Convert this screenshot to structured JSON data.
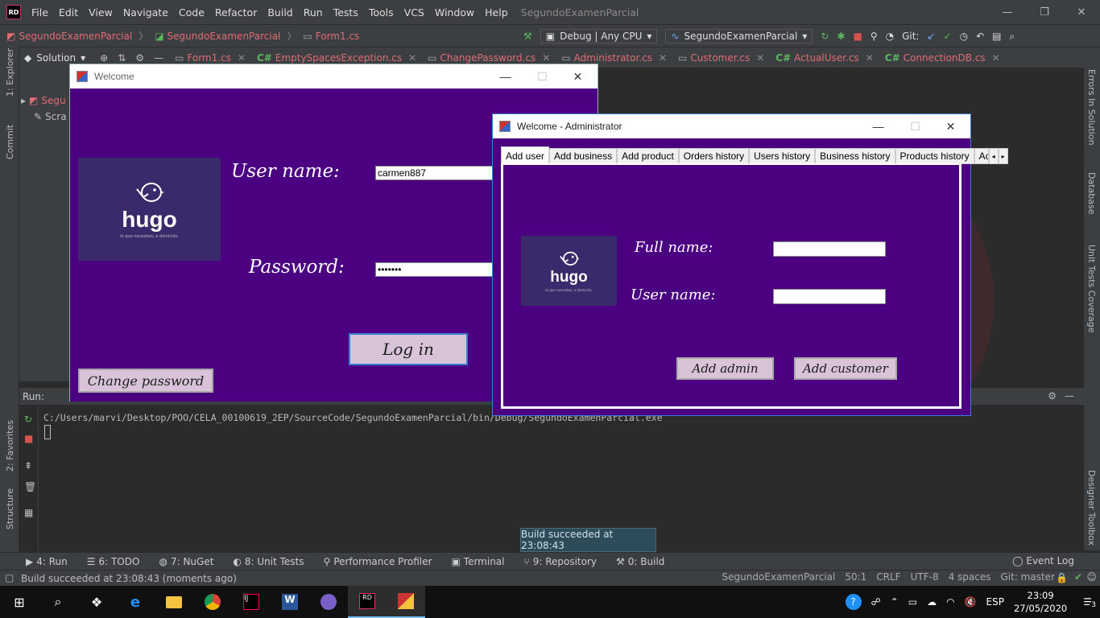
{
  "ide": {
    "logo": "RD",
    "menu": [
      "File",
      "Edit",
      "View",
      "Navigate",
      "Code",
      "Refactor",
      "Build",
      "Run",
      "Tests",
      "Tools",
      "VCS",
      "Window",
      "Help"
    ],
    "project_title": "SegundoExamenParcial",
    "breadcrumb": [
      "SegundoExamenParcial",
      "SegundoExamenParcial",
      "Form1.cs"
    ],
    "config": "Debug | Any CPU",
    "run_target": "SegundoExamenParcial",
    "git_label": "Git:",
    "solution_label": "Solution",
    "editor_tabs": [
      {
        "lang": "",
        "name": "Form1.cs"
      },
      {
        "lang": "C#",
        "name": "EmptySpacesException.cs"
      },
      {
        "lang": "",
        "name": "ChangePassword.cs"
      },
      {
        "lang": "",
        "name": "Administrator.cs"
      },
      {
        "lang": "",
        "name": "Customer.cs"
      },
      {
        "lang": "C#",
        "name": "ActualUser.cs"
      },
      {
        "lang": "C#",
        "name": "ConnectionDB.cs"
      }
    ],
    "tree_items": [
      "Segu",
      "Scra"
    ],
    "left_tools": [
      "1: Explorer",
      "Commit",
      "2: Favorites",
      "Structure"
    ],
    "right_tools": [
      "Errors In Solution",
      "Database",
      "Unit Tests Coverage",
      "Designer Toolbox"
    ],
    "run_label": "Run:",
    "run_path": "C:/Users/marvi/Desktop/POO/CELA_00100619_2EP/SourceCode/SegundoExamenParcial/bin/Debug/SegundoExamenParcial.exe",
    "toast": "Build succeeded at 23:08:43",
    "bottom_tools": [
      "4: Run",
      "6: TODO",
      "7: NuGet",
      "8: Unit Tests",
      "Performance Profiler",
      "Terminal",
      "9: Repository",
      "0: Build"
    ],
    "event_log": "Event Log",
    "status_message": "Build succeeded at 23:08:43 (moments ago)",
    "status_right": [
      "SegundoExamenParcial",
      "50:1",
      "CRLF",
      "UTF-8",
      "4 spaces",
      "Git: master"
    ]
  },
  "login_window": {
    "title": "Welcome",
    "logo_word": "hugo",
    "logo_tag": "lo que necesitas, a domicilio.",
    "username_label": "User name:",
    "username_value": "carmen887",
    "password_label": "Password:",
    "password_value": "•••••••",
    "login_button": "Log in",
    "change_password_button": "Change password"
  },
  "admin_window": {
    "title": "Welcome - Administrator",
    "tabs": [
      "Add user",
      "Add business",
      "Add product",
      "Orders history",
      "Users history",
      "Business history",
      "Products history",
      "Ac"
    ],
    "logo_word": "hugo",
    "logo_tag": "lo que necesitas, a domicilio.",
    "fullname_label": "Full name:",
    "fullname_value": "",
    "username_label": "User name:",
    "username_value": "",
    "add_admin_button": "Add admin",
    "add_customer_button": "Add customer"
  },
  "taskbar": {
    "lang": "ESP",
    "time": "23:09",
    "date": "27/05/2020",
    "notifications": "3"
  }
}
